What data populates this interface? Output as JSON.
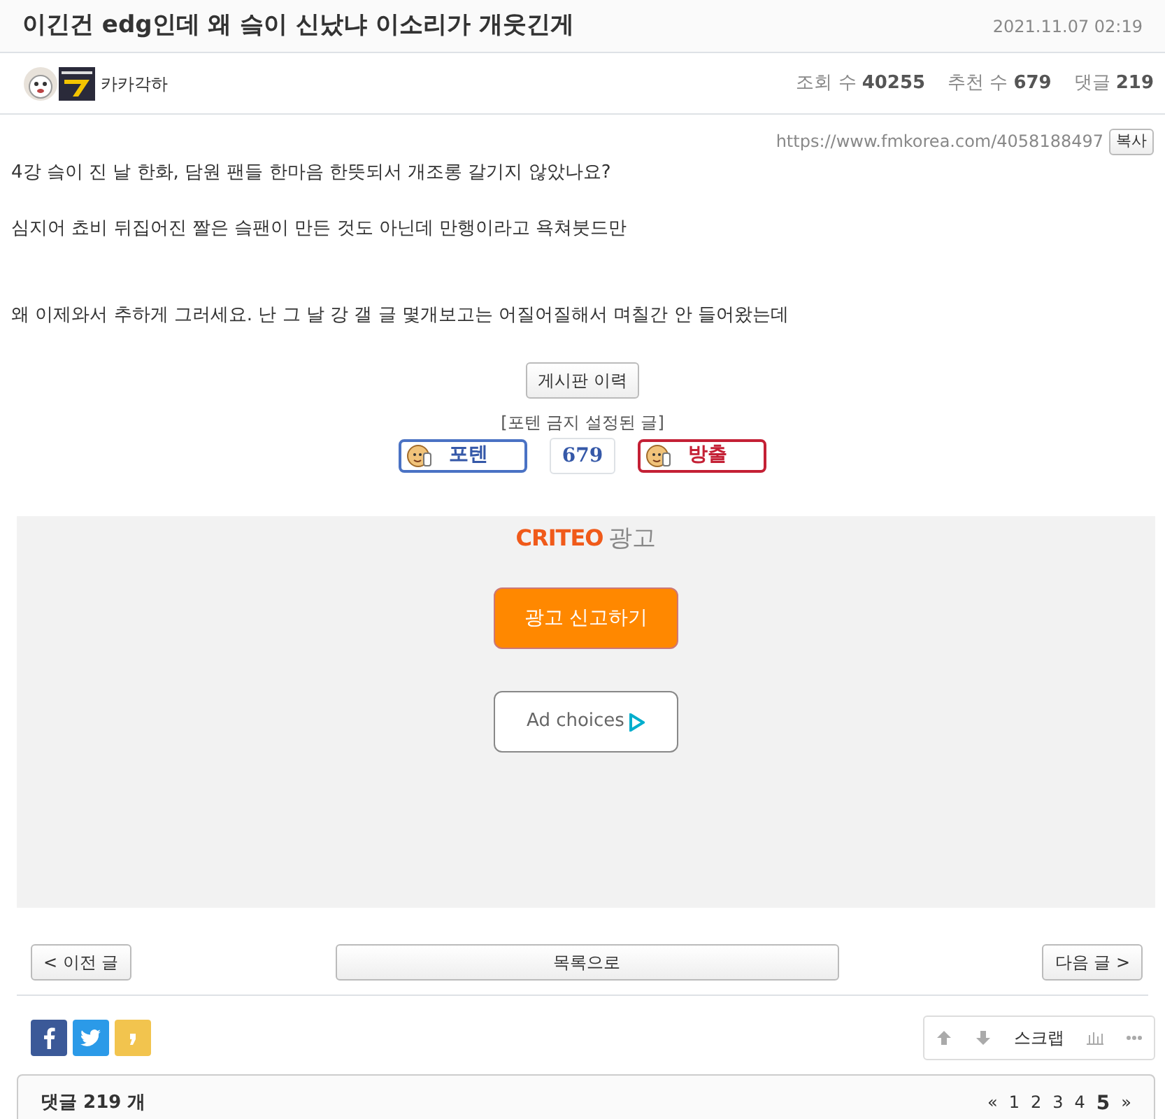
{
  "post": {
    "title": "이긴건 edg인데 왜 슼이 신났냐 이소리가 개웃긴게",
    "date": "2021.11.07 02:19",
    "author": "카카각하",
    "stats": [
      {
        "label": "조회 수",
        "value": "40255"
      },
      {
        "label": "추천 수",
        "value": "679"
      },
      {
        "label": "댓글",
        "value": "219"
      }
    ]
  },
  "url": "https://www.fmkorea.com/4058188497",
  "copy_button": "복사",
  "body": [
    "4강 슼이 진 날 한화, 담원 팬들 한마음 한뜻되서 개조롱 갈기지 않았나요?",
    "심지어 쵸비 뒤집어진 짤은 슼팬이 만든 것도 아닌데 만행이라고 욕쳐붓드만",
    "왜 이제와서 추하게 그러세요. 난 그 날 강 갤 글 몇개보고는 어질어질해서 며칠간 안 들어왔는데"
  ],
  "vote": {
    "history_button": "게시판 이력",
    "notice": "[포텐 금지 설정된 글]",
    "up_label": "포텐",
    "count": "679",
    "down_label": "방출"
  },
  "ad": {
    "brand": "CRITEO",
    "label": "광고",
    "report_button": "광고 신고하기",
    "choices": "Ad choices"
  },
  "nav": {
    "prev": "< 이전 글",
    "list": "목록으로",
    "next": "다음 글 >"
  },
  "actions": {
    "scrap": "스크랩"
  },
  "comments": {
    "title": "댓글 219 개",
    "pages": [
      {
        "label": "«",
        "selected": false
      },
      {
        "label": "1",
        "selected": false
      },
      {
        "label": "2",
        "selected": false
      },
      {
        "label": "3",
        "selected": false
      },
      {
        "label": "4",
        "selected": false
      },
      {
        "label": "5",
        "selected": true
      },
      {
        "label": "»",
        "selected": false
      }
    ]
  }
}
